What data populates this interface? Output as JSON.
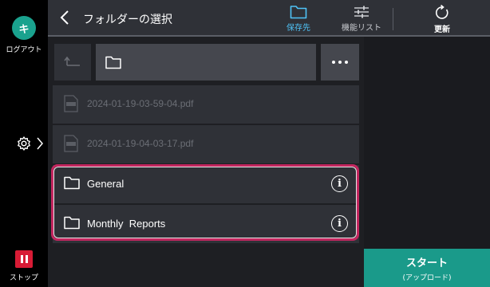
{
  "rail": {
    "logout_initial": "キ",
    "logout_label": "ログアウト",
    "stop_label": "ストップ"
  },
  "header": {
    "title": "フォルダーの選択",
    "save_to_label": "保存先",
    "function_list_label": "機能リスト",
    "refresh_label": "更新"
  },
  "files": [
    {
      "name": "2024-01-19-03-59-04.pdf",
      "icon": "pdf-file-icon"
    },
    {
      "name": "2024-01-19-04-03-17.pdf",
      "icon": "pdf-file-icon"
    }
  ],
  "folders": [
    {
      "name": "General",
      "icon": "folder-icon"
    },
    {
      "name": "Monthly  Reports",
      "icon": "folder-icon"
    }
  ],
  "start": {
    "label": "スタート",
    "sublabel": "(アップロード)"
  },
  "colors": {
    "accent": "#4fc3f7",
    "start": "#1a9a8a",
    "highlight": "#c3265f",
    "stop": "#d81b35",
    "avatar": "#1aa28e"
  }
}
